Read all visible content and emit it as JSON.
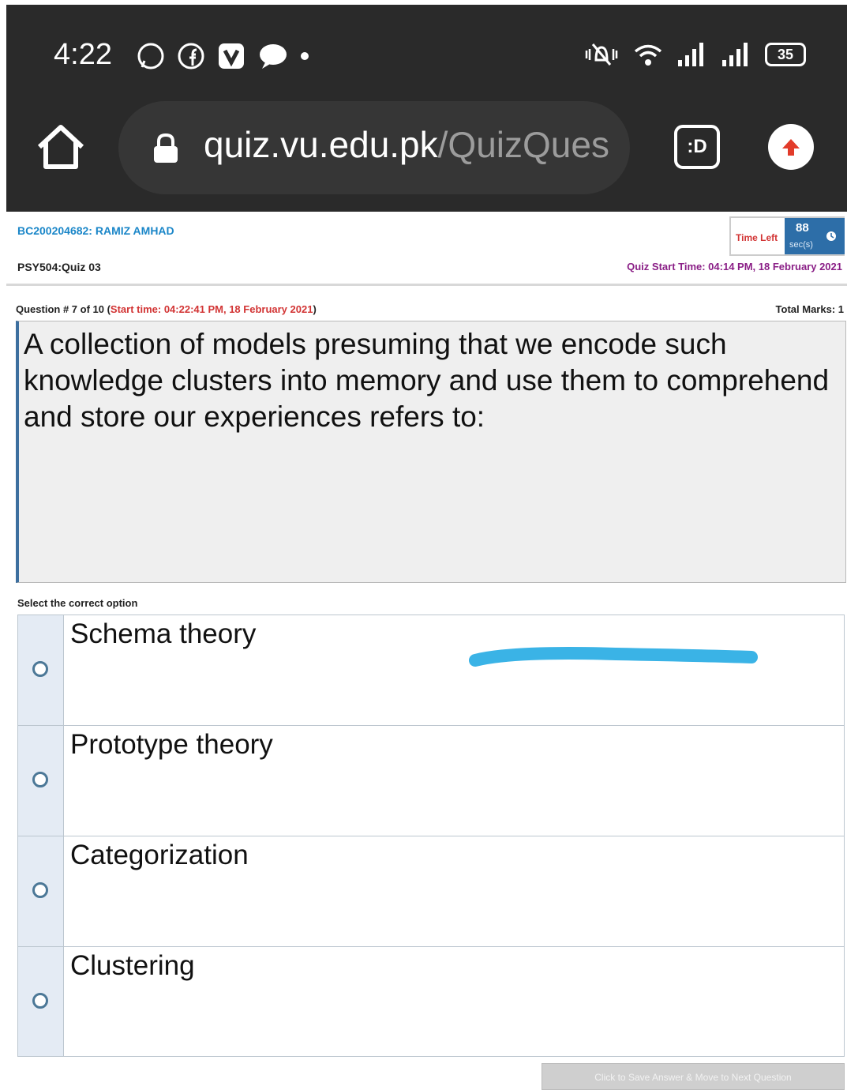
{
  "status_bar": {
    "time": "4:22",
    "battery": "35"
  },
  "browser": {
    "url_host": "quiz.vu.edu.pk",
    "url_path": "/QuizQues",
    "ext_label": ":D"
  },
  "header": {
    "student": "BC200204682: RAMIZ AMHAD",
    "course": "PSY504:Quiz 03",
    "time_left_label": "Time Left",
    "time_left_value": "88",
    "time_left_unit": "sec(s)",
    "quiz_start": "Quiz Start Time: 04:14 PM, 18 February 2021"
  },
  "question": {
    "meta_prefix": "Question # 7 of 10 (",
    "meta_start": "Start time: 04:22:41 PM, 18 February 2021",
    "meta_suffix": ")",
    "total_marks": "Total Marks: 1",
    "text": "A collection of models presuming that we encode such knowledge clusters into memory and use them to comprehend and store our experiences refers to:"
  },
  "select_label": "Select the correct option",
  "options": [
    {
      "label": "Schema theory"
    },
    {
      "label": "Prototype theory"
    },
    {
      "label": "Categorization"
    },
    {
      "label": "Clustering"
    }
  ],
  "next_button": "Click to Save Answer & Move to Next Question",
  "colors": {
    "accent": "#1a86c8",
    "timer_bg": "#2d6ea8",
    "alert_red": "#d23434",
    "scribble": "#3ab3e6"
  }
}
